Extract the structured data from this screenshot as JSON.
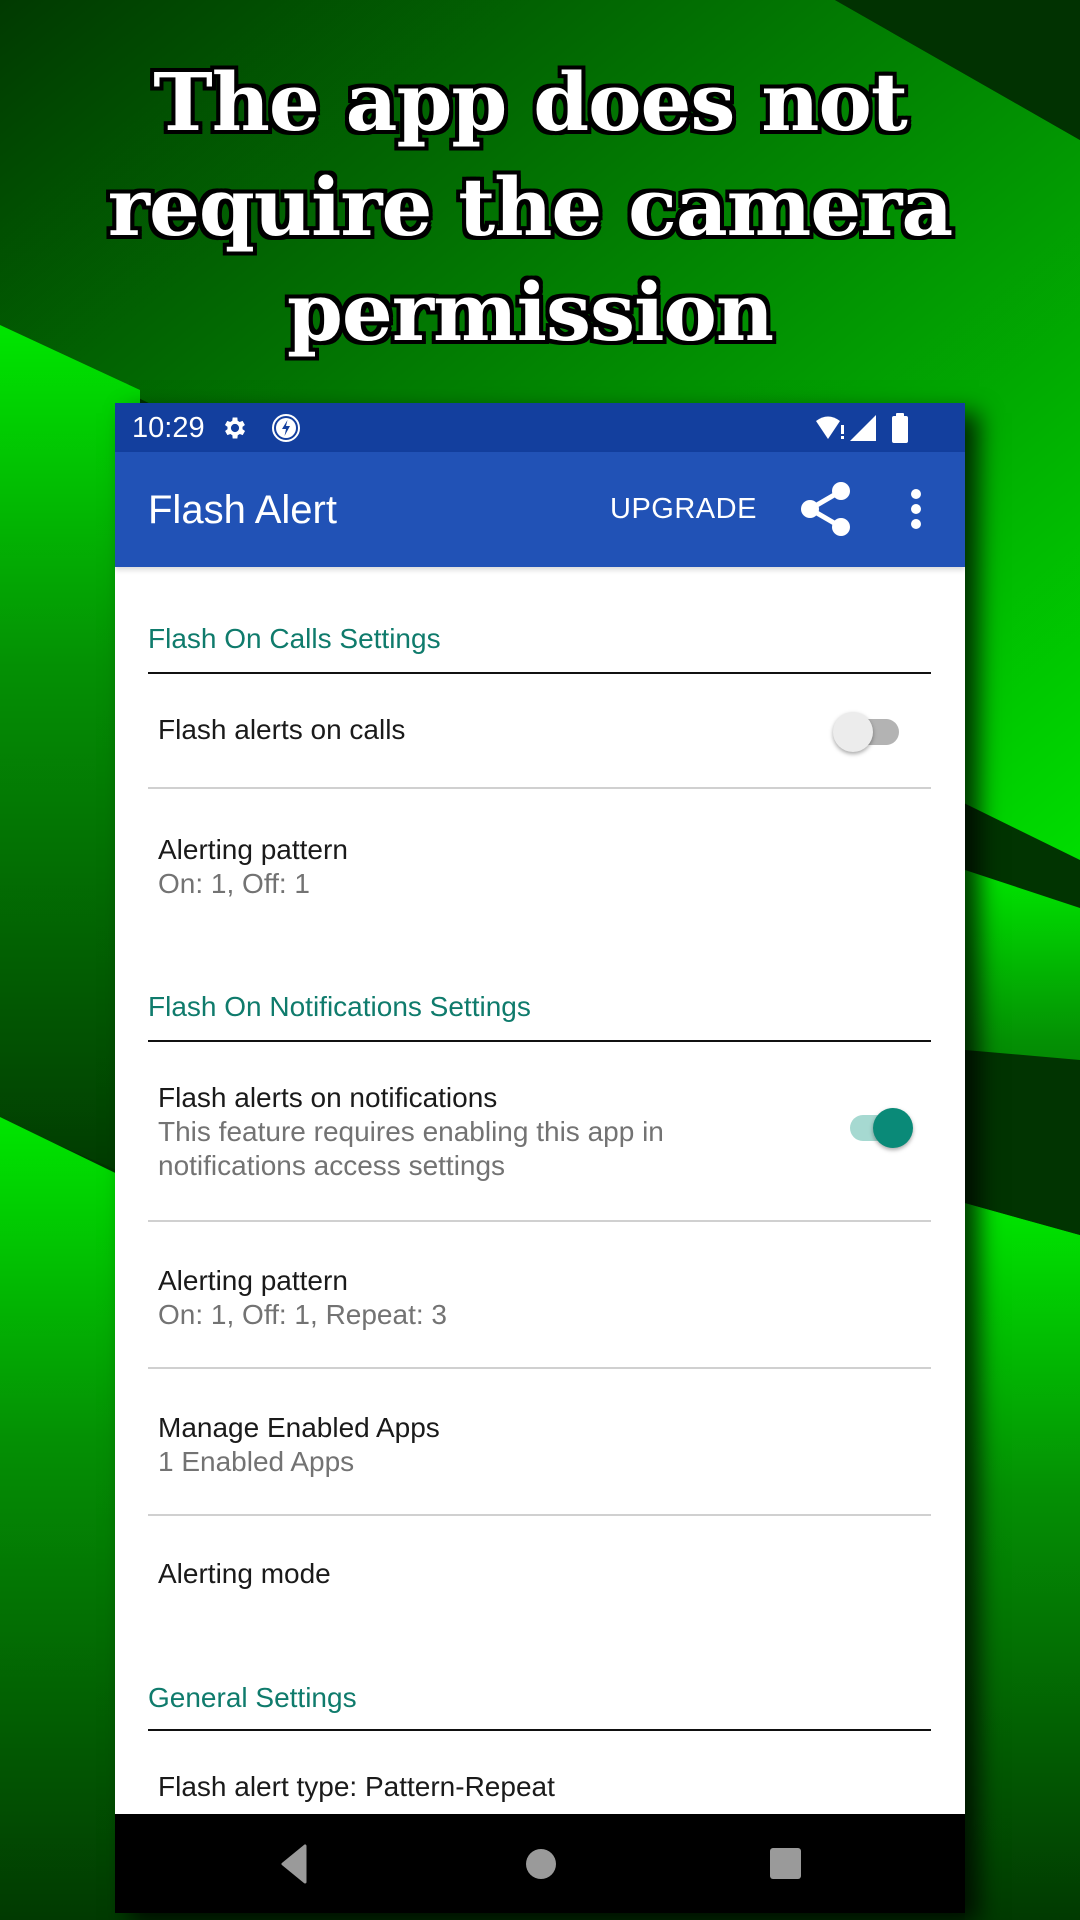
{
  "headline": {
    "lines": [
      "The app does not",
      "require the camera",
      "permission"
    ]
  },
  "colors": {
    "background_dark": "#013a01",
    "background_stripe": "#00d400",
    "status_bar": "#133f9e",
    "app_bar": "#2152b6",
    "accent": "#0f7b6c",
    "switch_on_thumb": "#0a8a78",
    "switch_on_track": "#a6d9d1",
    "switch_off_thumb": "#ececec",
    "switch_off_track": "#b3b3b3"
  },
  "status_bar": {
    "time": "10:29",
    "left_icons": [
      "settings-gear-icon",
      "flash-circle-icon"
    ],
    "right_icons": [
      "wifi-alert-icon",
      "cell-signal-icon",
      "battery-icon"
    ]
  },
  "app_bar": {
    "title": "Flash Alert",
    "upgrade_label": "UPGRADE",
    "share_icon": "share-icon",
    "more_icon": "more-vert-icon"
  },
  "sections": {
    "calls": {
      "title": "Flash On Calls Settings",
      "flash_calls": {
        "title": "Flash alerts on calls",
        "enabled": false
      },
      "pattern": {
        "title": "Alerting pattern",
        "summary": "On: 1, Off: 1"
      }
    },
    "notifications": {
      "title": "Flash On Notifications Settings",
      "flash_notifications": {
        "title": "Flash alerts on notifications",
        "summary_line1": "This feature requires enabling this app in",
        "summary_line2": "notifications access settings",
        "enabled": true
      },
      "pattern": {
        "title": "Alerting pattern",
        "summary": "On: 1, Off: 1, Repeat: 3"
      },
      "manage_apps": {
        "title": "Manage Enabled Apps",
        "summary": "1 Enabled Apps"
      },
      "mode": {
        "title": "Alerting mode"
      }
    },
    "general": {
      "title": "General Settings",
      "alert_type": {
        "title": "Flash alert type: Pattern-Repeat"
      }
    }
  },
  "nav_bar": {
    "back_icon": "back-triangle-icon",
    "home_icon": "home-circle-icon",
    "recents_icon": "recents-square-icon"
  }
}
